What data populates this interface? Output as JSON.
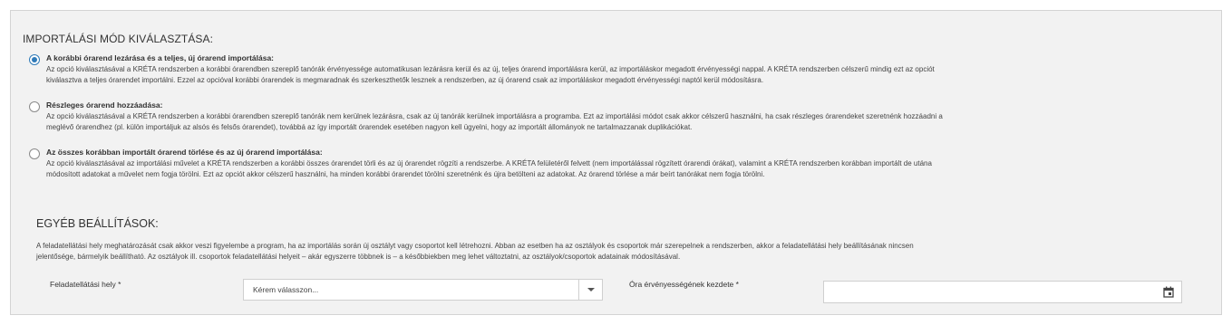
{
  "import_mode": {
    "title": "IMPORTÁLÁSI MÓD KIVÁLASZTÁSA:",
    "options": [
      {
        "title": "A korábbi órarend lezárása és a teljes, új órarend importálása:",
        "line1": "Az opció kiválasztásával a KRÉTA rendszerben a korábbi órarendben szereplő tanórák érvényessége automatikusan lezárásra kerül és az új, teljes órarend importálásra kerül, az importáláskor megadott érvényességi nappal. A KRÉTA rendszerben célszerű mindig ezt az opciót",
        "line2": "kiválasztva a teljes órarendet importálni. Ezzel az opcióval korábbi órarendek is megmaradnak és szerkeszthetők lesznek a rendszerben, az új órarend csak az importáláskor megadott érvényességi naptól kerül módosításra.",
        "checked": true
      },
      {
        "title": "Részleges órarend hozzáadása:",
        "line1": "Az opció kiválasztásával a KRÉTA rendszerben a korábbi órarendben szereplő tanórák nem kerülnek lezárásra, csak az új tanórák kerülnek importálásra a programba. Ezt az importálási módot csak akkor célszerű használni, ha csak részleges órarendeket szeretnénk hozzáadni a",
        "line2": "meglévő órarendhez (pl. külön importáljuk az alsós és felsős órarendet), továbbá az így importált órarendek esetében nagyon kell ügyelni, hogy az importált állományok ne tartalmazzanak duplikációkat.",
        "checked": false
      },
      {
        "title": "Az összes korábban importált órarend törlése és az új órarend importálása:",
        "line1": "Az opció kiválasztásával az importálási művelet a KRÉTA rendszerben a korábbi összes órarendet törli és az új órarendet rögzíti a rendszerbe. A KRÉTA felületéről felvett (nem importálással rögzített órarendi órákat), valamint a KRÉTA rendszerben korábban importált de utána",
        "line2": "módosított adatokat a művelet nem fogja törölni. Ezt az opciót akkor célszerű használni, ha minden korábbi órarendet törölni szeretnénk és újra betölteni az adatokat. Az órarend törlése a már beírt tanórákat nem fogja törölni.",
        "checked": false
      }
    ]
  },
  "other_settings": {
    "title": "EGYÉB BEÁLLÍTÁSOK:",
    "note_line1": "A feladatellátási hely meghatározását csak akkor veszi figyelembe a program, ha az importálás során új osztályt vagy csoportot kell létrehozni. Abban az esetben ha az osztályok és csoportok már szerepelnek a rendszerben, akkor a feladatellátási hely beállításának nincsen",
    "note_line2": "jelentősége, bármelyik beállítható. Az osztályok ill. csoportok feladatellátási helyeit – akár egyszerre többnek is – a későbbiekben meg lehet változtatni, az osztályok/csoportok adatainak módosításával.",
    "location_label": "Feladatellátási hely *",
    "location_placeholder": "Kérem válasszon...",
    "date_label": "Óra érvényességének kezdete *",
    "date_value": ""
  },
  "colors": {
    "panel_bg": "#f2f2f2",
    "accent": "#2f7ab8"
  },
  "icons": {
    "dropdown": "chevron-down-icon",
    "date": "calendar-icon"
  }
}
